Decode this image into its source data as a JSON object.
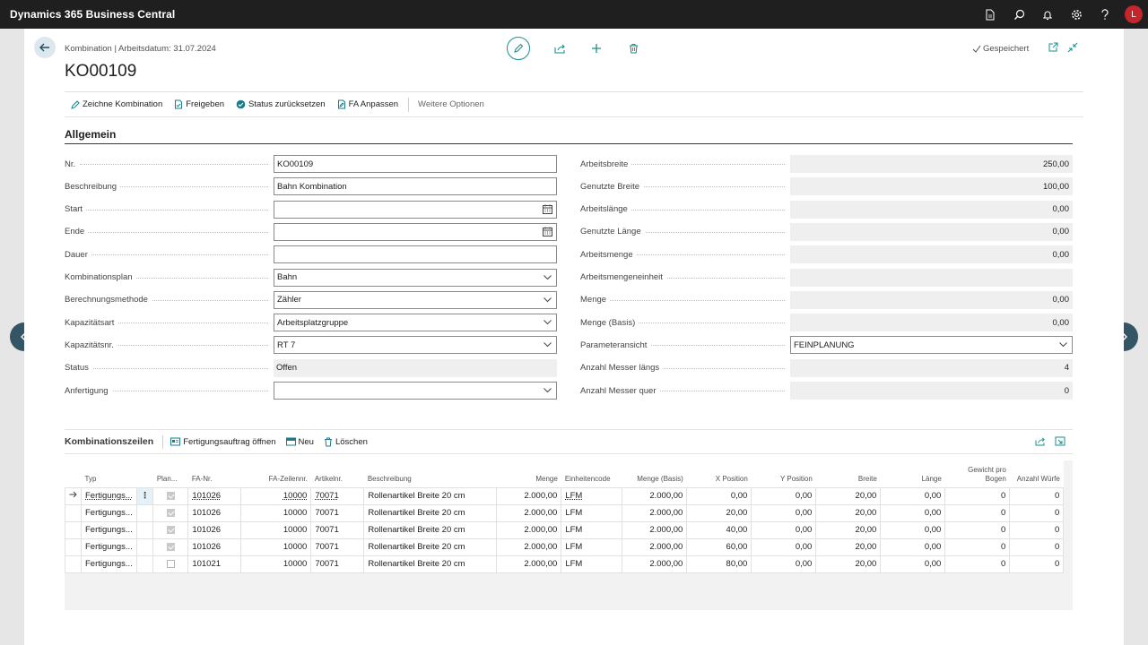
{
  "app": {
    "title": "Dynamics 365 Business Central",
    "user_initial": "L"
  },
  "header": {
    "breadcrumb": "Kombination | Arbeitsdatum: 31.07.2024",
    "title": "KO00109",
    "saved": "Gespeichert"
  },
  "actions": {
    "zeichne": "Zeichne Kombination",
    "freigeben": "Freigeben",
    "status_reset": "Status zurücksetzen",
    "fa_anpassen": "FA Anpassen",
    "more": "Weitere Optionen"
  },
  "general": {
    "title": "Allgemein",
    "left": [
      {
        "label": "Nr.",
        "value": "KO00109",
        "kind": "text"
      },
      {
        "label": "Beschreibung",
        "value": "Bahn Kombination",
        "kind": "text"
      },
      {
        "label": "Start",
        "value": "",
        "kind": "date"
      },
      {
        "label": "Ende",
        "value": "",
        "kind": "date"
      },
      {
        "label": "Dauer",
        "value": "",
        "kind": "text"
      },
      {
        "label": "Kombinationsplan",
        "value": "Bahn",
        "kind": "select"
      },
      {
        "label": "Berechnungsmethode",
        "value": "Zähler",
        "kind": "select"
      },
      {
        "label": "Kapazitätsart",
        "value": "Arbeitsplatzgruppe",
        "kind": "select"
      },
      {
        "label": "Kapazitätsnr.",
        "value": "RT 7",
        "kind": "select"
      },
      {
        "label": "Status",
        "value": "Offen",
        "kind": "readonly"
      },
      {
        "label": "Anfertigung",
        "value": "",
        "kind": "select"
      }
    ],
    "right": [
      {
        "label": "Arbeitsbreite",
        "value": "250,00",
        "kind": "readonly-num"
      },
      {
        "label": "Genutzte Breite",
        "value": "100,00",
        "kind": "readonly-num"
      },
      {
        "label": "Arbeitslänge",
        "value": "0,00",
        "kind": "readonly-num"
      },
      {
        "label": "Genutzte Länge",
        "value": "0,00",
        "kind": "readonly-num"
      },
      {
        "label": "Arbeitsmenge",
        "value": "0,00",
        "kind": "readonly-num"
      },
      {
        "label": "Arbeitsmengeneinheit",
        "value": "",
        "kind": "readonly-num"
      },
      {
        "label": "Menge",
        "value": "0,00",
        "kind": "readonly-num"
      },
      {
        "label": "Menge (Basis)",
        "value": "0,00",
        "kind": "readonly-num"
      },
      {
        "label": "Parameteransicht",
        "value": "FEINPLANUNG",
        "kind": "select"
      },
      {
        "label": "Anzahl Messer längs",
        "value": "4",
        "kind": "readonly-num"
      },
      {
        "label": "Anzahl Messer quer",
        "value": "0",
        "kind": "readonly-num"
      }
    ]
  },
  "lines": {
    "title": "Kombinationszeilen",
    "btn_open": "Fertigungsauftrag öffnen",
    "btn_new": "Neu",
    "btn_delete": "Löschen",
    "columns": [
      "Typ",
      "Plan...",
      "FA-Nr.",
      "FA-Zeilennr.",
      "Artikelnr.",
      "Beschreibung",
      "Menge",
      "Einheitencode",
      "Menge (Basis)",
      "X Position",
      "Y Position",
      "Breite",
      "Länge",
      "Gewicht pro Bogen",
      "Anzahl Würfe"
    ],
    "rows": [
      {
        "typ": "Fertigungs...",
        "plan": true,
        "fa_nr": "101026",
        "fa_zeile": "10000",
        "artikel": "70071",
        "beschreibung": "Rollenartikel Breite 20 cm",
        "menge": "2.000,00",
        "einheit": "LFM",
        "menge_basis": "2.000,00",
        "x": "0,00",
        "y": "0,00",
        "breite": "20,00",
        "laenge": "0,00",
        "gewicht": "0",
        "wuerfe": "0"
      },
      {
        "typ": "Fertigungs...",
        "plan": true,
        "fa_nr": "101026",
        "fa_zeile": "10000",
        "artikel": "70071",
        "beschreibung": "Rollenartikel Breite 20 cm",
        "menge": "2.000,00",
        "einheit": "LFM",
        "menge_basis": "2.000,00",
        "x": "20,00",
        "y": "0,00",
        "breite": "20,00",
        "laenge": "0,00",
        "gewicht": "0",
        "wuerfe": "0"
      },
      {
        "typ": "Fertigungs...",
        "plan": true,
        "fa_nr": "101026",
        "fa_zeile": "10000",
        "artikel": "70071",
        "beschreibung": "Rollenartikel Breite 20 cm",
        "menge": "2.000,00",
        "einheit": "LFM",
        "menge_basis": "2.000,00",
        "x": "40,00",
        "y": "0,00",
        "breite": "20,00",
        "laenge": "0,00",
        "gewicht": "0",
        "wuerfe": "0"
      },
      {
        "typ": "Fertigungs...",
        "plan": true,
        "fa_nr": "101026",
        "fa_zeile": "10000",
        "artikel": "70071",
        "beschreibung": "Rollenartikel Breite 20 cm",
        "menge": "2.000,00",
        "einheit": "LFM",
        "menge_basis": "2.000,00",
        "x": "60,00",
        "y": "0,00",
        "breite": "20,00",
        "laenge": "0,00",
        "gewicht": "0",
        "wuerfe": "0"
      },
      {
        "typ": "Fertigungs...",
        "plan": false,
        "fa_nr": "101021",
        "fa_zeile": "10000",
        "artikel": "70071",
        "beschreibung": "Rollenartikel Breite 20 cm",
        "menge": "2.000,00",
        "einheit": "LFM",
        "menge_basis": "2.000,00",
        "x": "80,00",
        "y": "0,00",
        "breite": "20,00",
        "laenge": "0,00",
        "gewicht": "0",
        "wuerfe": "0"
      }
    ]
  },
  "colors": {
    "topbar": "#1f1f1f",
    "accent": "#1a8f8f",
    "nav_circle": "#345566",
    "avatar": "#c4262e"
  }
}
